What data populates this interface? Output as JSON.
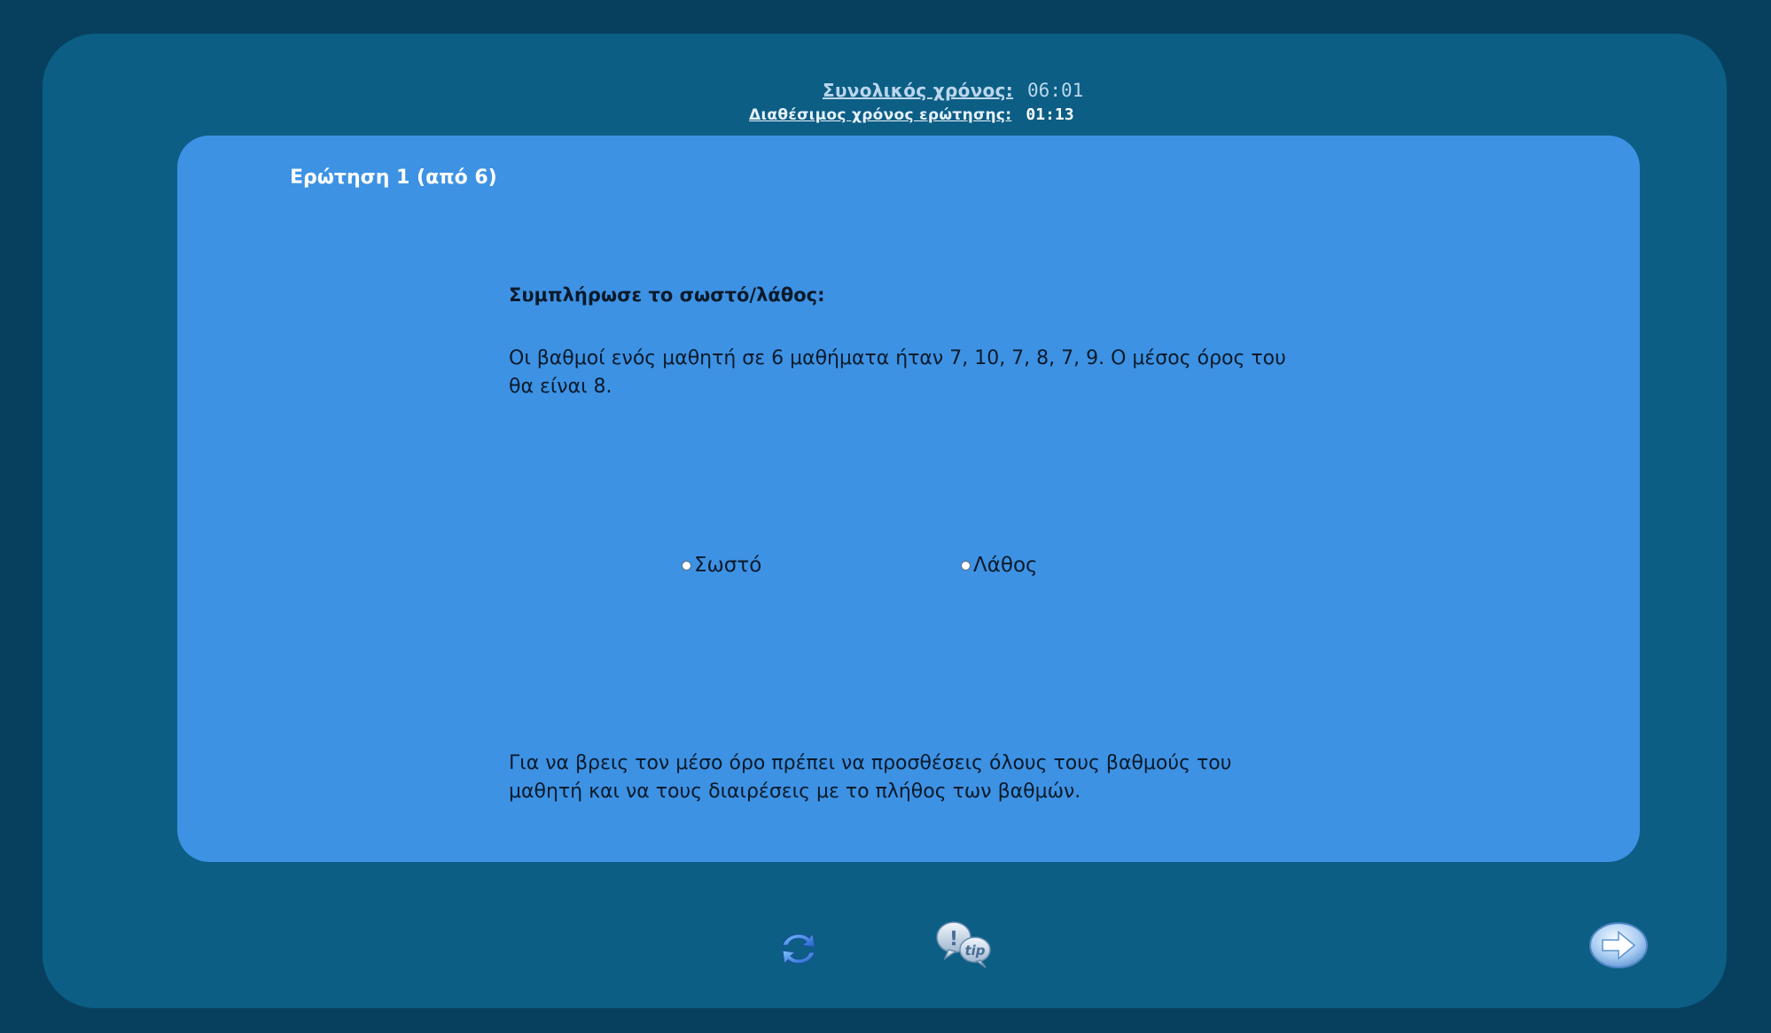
{
  "timers": {
    "total_label": "Συνολικός χρόνος:",
    "total_value": "06:01",
    "question_label": "Διαθέσιμος χρόνος ερώτησης:",
    "question_value": "01:13"
  },
  "question": {
    "number_label": "Ερώτηση 1 (από 6)",
    "instruction": "Συμπλήρωσε το σωστό/λάθος:",
    "text": "Οι βαθμοί ενός μαθητή σε 6 μαθήματα ήταν 7, 10, 7, 8, 7, 9. Ο μέσος όρος του θα είναι 8.",
    "options": [
      {
        "label": "Σωστό",
        "selected": false
      },
      {
        "label": "Λάθος",
        "selected": false
      }
    ],
    "hint": "Για να βρεις τον μέσο όρο πρέπει να προσθέσεις όλους τους βαθμούς του μαθητή και να τους διαιρέσεις με το πλήθος των βαθμών."
  },
  "toolbar": {
    "refresh_icon": "refresh-icon",
    "tip_icon": "tip-icon",
    "next_icon": "arrow-right-icon"
  },
  "colors": {
    "page_background": "#07405e",
    "frame_background": "#0c5e85",
    "card_background": "#3d92e4",
    "text_dark": "#0b1a2a",
    "text_light": "#ffffff"
  }
}
